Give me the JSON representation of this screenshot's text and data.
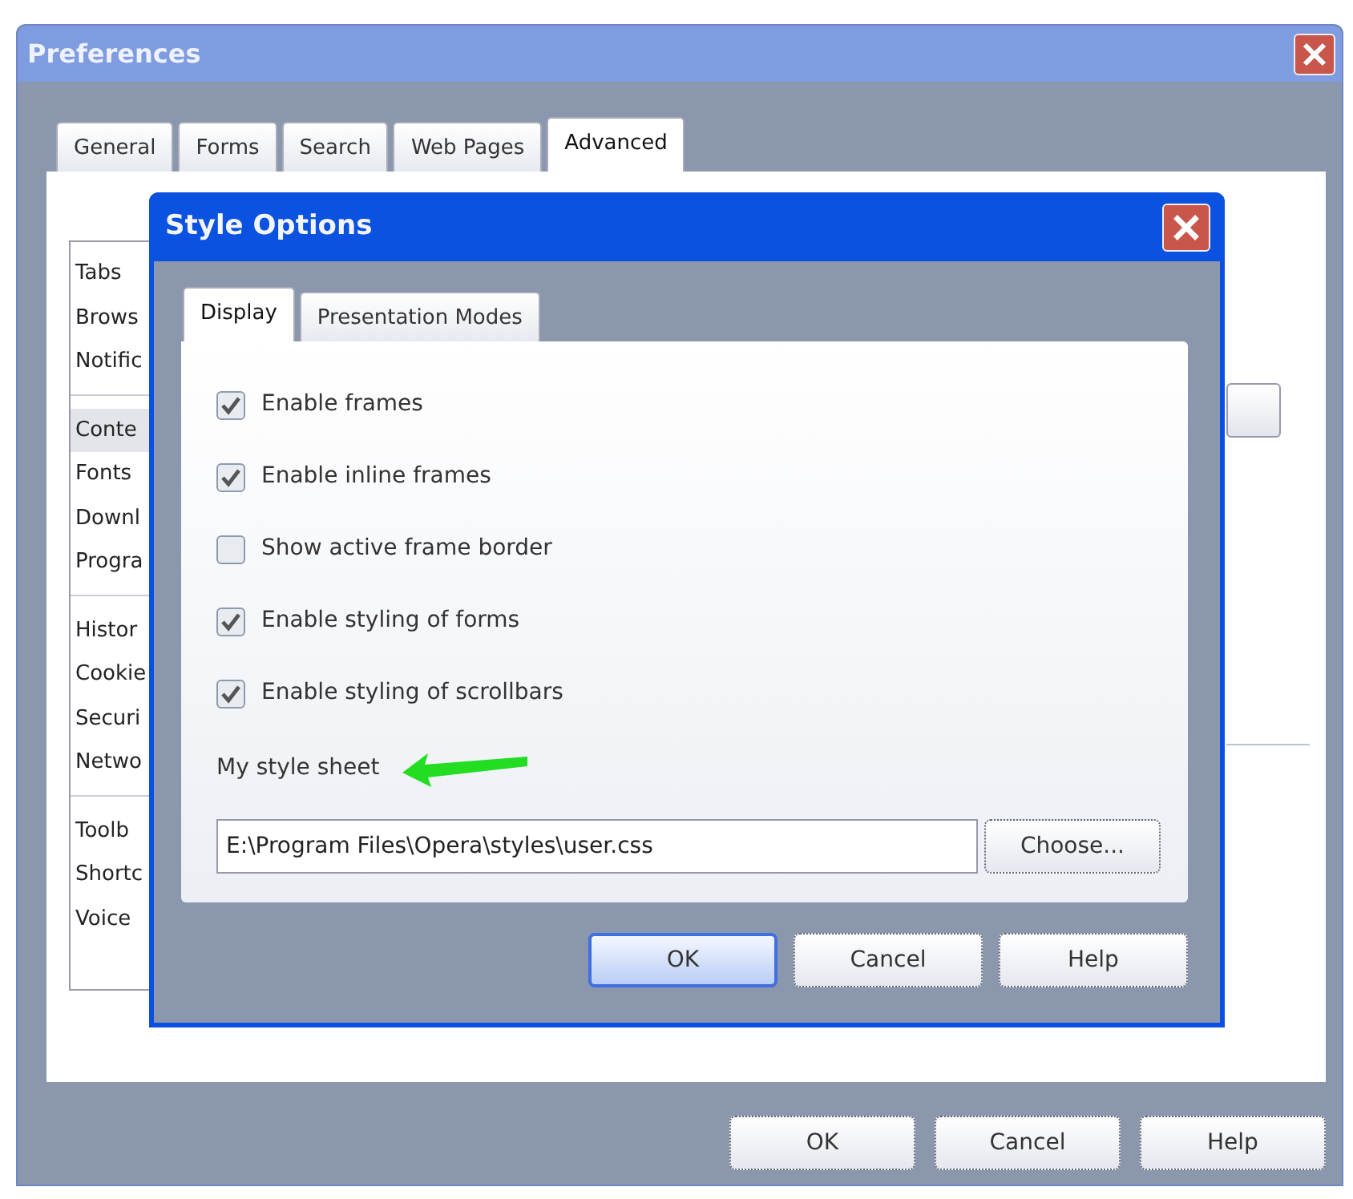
{
  "window": {
    "title": "Preferences"
  },
  "tabs": [
    {
      "label": "General",
      "selected": false
    },
    {
      "label": "Forms",
      "selected": false
    },
    {
      "label": "Search",
      "selected": false
    },
    {
      "label": "Web Pages",
      "selected": false
    },
    {
      "label": "Advanced",
      "selected": true
    }
  ],
  "sidebar": {
    "groups": [
      [
        {
          "label": "Tabs",
          "selected": false
        },
        {
          "label": "Brows",
          "selected": false
        },
        {
          "label": "Notific",
          "selected": false
        }
      ],
      [
        {
          "label": "Conte",
          "selected": true
        },
        {
          "label": "Fonts",
          "selected": false
        },
        {
          "label": "Downl",
          "selected": false
        },
        {
          "label": "Progra",
          "selected": false
        }
      ],
      [
        {
          "label": "Histor",
          "selected": false
        },
        {
          "label": "Cookie",
          "selected": false
        },
        {
          "label": "Securi",
          "selected": false
        },
        {
          "label": "Netwo",
          "selected": false
        }
      ],
      [
        {
          "label": "Toolb",
          "selected": false
        },
        {
          "label": "Shortc",
          "selected": false
        },
        {
          "label": "Voice",
          "selected": false
        }
      ]
    ]
  },
  "buttons": [
    {
      "label": "OK",
      "default": false
    },
    {
      "label": "Cancel",
      "default": false
    },
    {
      "label": "Help",
      "default": false
    }
  ],
  "dialog": {
    "title": "Style Options",
    "tabs": [
      {
        "label": "Display",
        "selected": true
      },
      {
        "label": "Presentation Modes",
        "selected": false
      }
    ],
    "options": [
      {
        "label": "Enable frames",
        "checked": true
      },
      {
        "label": "Enable inline frames",
        "checked": true
      },
      {
        "label": "Show active frame border",
        "checked": false
      },
      {
        "label": "Enable styling of forms",
        "checked": true
      },
      {
        "label": "Enable styling of scrollbars",
        "checked": true
      }
    ],
    "style_sheet": {
      "label": "My style sheet",
      "value": "E:\\Program Files\\Opera\\styles\\user.css",
      "button": "Choose..."
    },
    "buttons": [
      {
        "label": "OK",
        "default": true
      },
      {
        "label": "Cancel",
        "default": false
      },
      {
        "label": "Help",
        "default": false
      }
    ]
  }
}
